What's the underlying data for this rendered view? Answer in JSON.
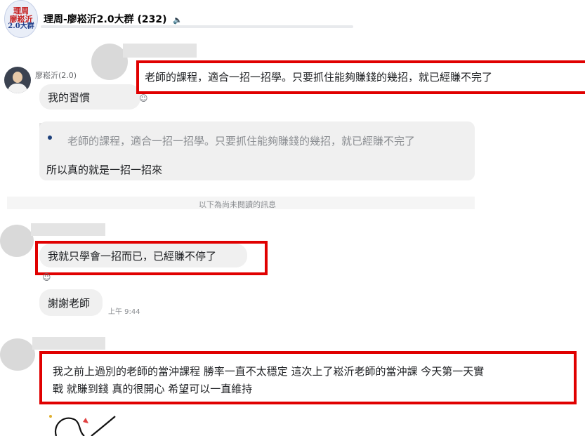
{
  "header": {
    "avatar_lines": [
      "理周",
      "廖崧沂",
      "2.0大群"
    ],
    "group_title": "理周-廖崧沂2.0大群 (232)",
    "speaker_icon": "speaker-icon"
  },
  "messages": {
    "highlighted_quote": "老師的課程，適合一招一招學。只要抓住能夠賺錢的幾招，就已經賺不完了",
    "sender_name": "廖崧沂(2.0)",
    "reply_partial": "我的習慣",
    "reply_quote": "老師的課程，適合一招一招學。只要抓住能夠賺錢的幾招，就已經賺不完了",
    "reply_text": "所以真的就是一招一招來",
    "unread_divider": "以下為尚未閱讀的訊息",
    "msg_learned_one": "我就只學會一招而已，已經賺不停了",
    "msg_thanks": "謝謝老師",
    "thanks_time": "上午 9:44",
    "msg_long_line1": "我之前上過別的老師的當沖課程 勝率一直不太穩定  這次上了崧沂老師的當沖課 今天第一天實",
    "msg_long_line2": "戰 就賺到錢 真的很開心 希望可以一直維持"
  },
  "colors": {
    "highlight_border": "#e00000",
    "bubble_bg": "#f0f0f0",
    "muted_text": "#8a8d91"
  }
}
